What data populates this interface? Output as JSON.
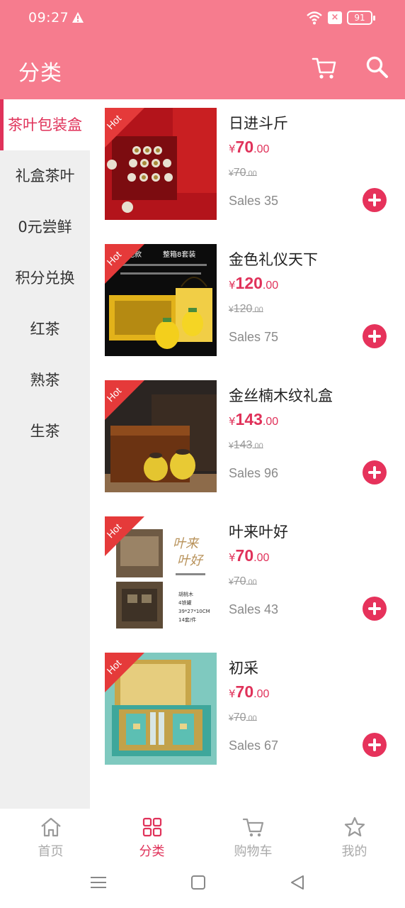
{
  "status": {
    "time": "09:27",
    "battery": "91"
  },
  "header": {
    "title": "分类"
  },
  "sidebar": {
    "items": [
      {
        "label": "茶叶包装盒"
      },
      {
        "label": "礼盒茶叶"
      },
      {
        "label": "0元尝鲜"
      },
      {
        "label": "积分兑换"
      },
      {
        "label": "红茶"
      },
      {
        "label": "熟茶"
      },
      {
        "label": "生茶"
      }
    ]
  },
  "products": [
    {
      "badge": "Hot",
      "name": "日进斗斤",
      "currency": "¥",
      "price_int": "70",
      "price_dec": ".00",
      "orig_int": "70",
      "orig_dec": ".00",
      "sales": "Sales 35"
    },
    {
      "badge": "Hot",
      "name": "金色礼仪天下",
      "currency": "¥",
      "price_int": "120",
      "price_dec": ".00",
      "orig_int": "120",
      "orig_dec": ".00",
      "sales": "Sales 75",
      "image_text": {
        "line1": "金色款",
        "line2": "整箱8套装"
      }
    },
    {
      "badge": "Hot",
      "name": "金丝楠木纹礼盒",
      "currency": "¥",
      "price_int": "143",
      "price_dec": ".00",
      "orig_int": "143",
      "orig_dec": ".00",
      "sales": "Sales 96"
    },
    {
      "badge": "Hot",
      "name": "叶来叶好",
      "currency": "¥",
      "price_int": "70",
      "price_dec": ".00",
      "orig_int": "70",
      "orig_dec": ".00",
      "sales": "Sales 43",
      "image_text": {
        "title1": "叶来",
        "title2": "叶好",
        "spec1": "胡桃木",
        "spec2": "4铁罐",
        "spec3": "39*27*10CM",
        "spec4": "14套/件"
      }
    },
    {
      "badge": "Hot",
      "name": "初采",
      "currency": "¥",
      "price_int": "70",
      "price_dec": ".00",
      "orig_int": "70",
      "orig_dec": ".00",
      "sales": "Sales 67"
    }
  ],
  "bottom_nav": {
    "items": [
      {
        "label": "首页",
        "icon": "home-icon"
      },
      {
        "label": "分类",
        "icon": "grid-icon"
      },
      {
        "label": "购物车",
        "icon": "cart-icon"
      },
      {
        "label": "我的",
        "icon": "star-icon"
      }
    ]
  },
  "colors": {
    "header_bg": "#f67c8e",
    "accent": "#e0325a",
    "sidebar_bg": "#efefef",
    "hot_badge": "#e53a3a"
  }
}
